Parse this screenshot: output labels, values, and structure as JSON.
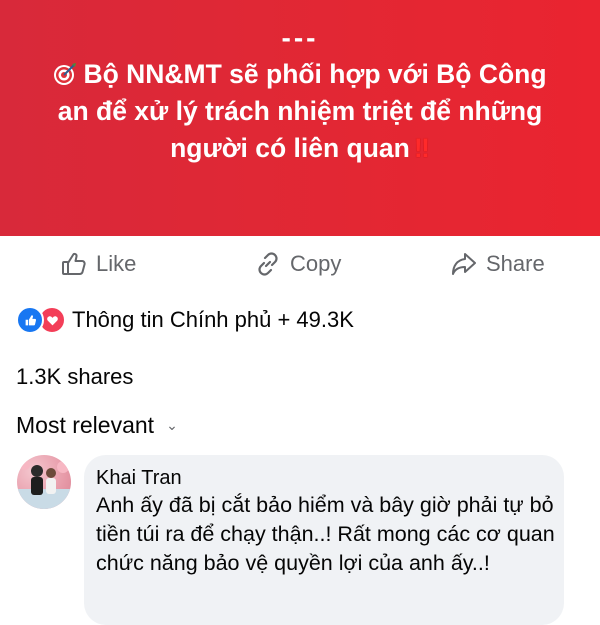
{
  "banner": {
    "dashes": "---",
    "headline": "Bộ NN&MT sẽ phối hợp với Bộ Công an để xử lý trách nhiệm triệt để những người có liên quan",
    "emoji_lead": "dart-target-icon",
    "emoji_trail": "double-exclamation-icon",
    "trail_text": "‼",
    "bg_color": "#e32733"
  },
  "actions": {
    "like_label": "Like",
    "copy_label": "Copy",
    "share_label": "Share"
  },
  "reactions": {
    "summary": "Thông tin Chính phủ + 49.3K",
    "icons": [
      "like-reaction-icon",
      "love-reaction-icon"
    ]
  },
  "shares": "1.3K shares",
  "sort": {
    "label": "Most relevant",
    "chevron": "⌄"
  },
  "comment": {
    "author": "Khai Tran",
    "text": "Anh ấy đã bị cắt bảo hiểm và bây giờ phải tự bỏ tiền túi ra để chạy thận..! Rất mong các cơ quan chức năng bảo vệ quyền lợi của anh ấy..!"
  }
}
